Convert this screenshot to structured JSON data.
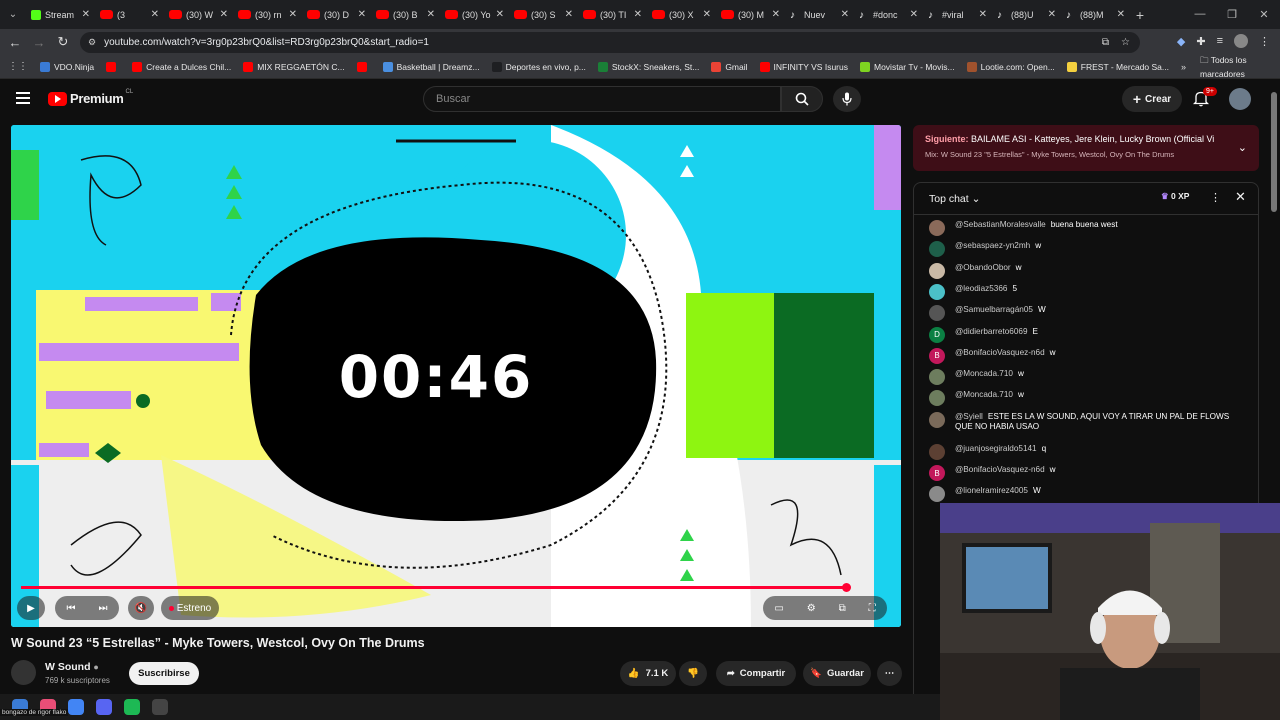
{
  "browser": {
    "tabs": [
      {
        "label": "Stream",
        "fav": "k"
      },
      {
        "label": "(3",
        "fav": "yt"
      },
      {
        "label": "(30) W",
        "fav": "yt"
      },
      {
        "label": "(30) rn",
        "fav": "yt"
      },
      {
        "label": "(30) D",
        "fav": "yt"
      },
      {
        "label": "(30) B",
        "fav": "yt"
      },
      {
        "label": "(30) Yo",
        "fav": "yt"
      },
      {
        "label": "(30) S",
        "fav": "yt"
      },
      {
        "label": "(30) TI",
        "fav": "yt"
      },
      {
        "label": "(30) X",
        "fav": "yt"
      },
      {
        "label": "(30) M",
        "fav": "yt"
      },
      {
        "label": "Nuev",
        "fav": "tt"
      },
      {
        "label": "#donc",
        "fav": "tt"
      },
      {
        "label": "#viral",
        "fav": "tt"
      },
      {
        "label": "(88)U",
        "fav": "tt"
      },
      {
        "label": "(88)M",
        "fav": "tt"
      }
    ],
    "url": "youtube.com/watch?v=3rg0p23brQ0&list=RD3rg0p23brQ0&start_radio=1",
    "bookmarks": [
      {
        "label": "VDO.Ninja",
        "color": "#3a7bd5"
      },
      {
        "label": "",
        "color": "#ff0000"
      },
      {
        "label": "Create a Dulces Chil...",
        "color": "#ff0000"
      },
      {
        "label": "MIX REGGAETÓN C...",
        "color": "#ff0000"
      },
      {
        "label": "",
        "color": "#ff0000"
      },
      {
        "label": "Basketball | Dreamz...",
        "color": "#4a8fe0"
      },
      {
        "label": "Deportes en vivo, p...",
        "color": "#1e1f22"
      },
      {
        "label": "StockX: Sneakers, St...",
        "color": "#1a7f37"
      },
      {
        "label": "Gmail",
        "color": "#ea4335"
      },
      {
        "label": "INFINITY VS Isurus",
        "color": "#ff0000"
      },
      {
        "label": "Movistar Tv - Movis...",
        "color": "#7ed321"
      },
      {
        "label": "Lootie.com: Open...",
        "color": "#a0522d"
      },
      {
        "label": "FREST - Mercado Sa...",
        "color": "#f4d03f"
      }
    ],
    "bookmarks_more": "»",
    "bookmarks_folder": "Todos los marcadores"
  },
  "yt": {
    "brand": "Premium",
    "country": "CL",
    "search_placeholder": "Buscar",
    "create_label": "Crear",
    "notif_badge": "9+"
  },
  "video": {
    "timer": "00:46",
    "premiere_label": "Estreno",
    "title": "W Sound 23 “5 Estrellas” - Myke Towers, Westcol, Ovy On The Drums",
    "channel": "W Sound",
    "subscribers": "769 k suscriptores",
    "subscribe_label": "Suscribirse",
    "likes": "7.1 K",
    "share_label": "Compartir",
    "save_label": "Guardar",
    "progress": 0.97
  },
  "next": {
    "prefix": "Siguiente:",
    "title": "BAILAME ASI - Katteyes, Jere Klein, Lucky Brown (Official Vi...",
    "mix": "Mix: W Sound 23 \"5 Estrellas\" - Myke Towers, Westcol, Ovy On The Drums"
  },
  "chat": {
    "mode": "Top chat",
    "xp": "0 XP",
    "messages": [
      {
        "name": "@SebastianMoralesvalle",
        "text": "buena buena west",
        "color": "#8a6a5a",
        "initial": ""
      },
      {
        "name": "@sebaspaez-yn2mh",
        "text": "w",
        "color": "#1e5f4a",
        "initial": ""
      },
      {
        "name": "@ObandoObor",
        "text": "w",
        "color": "#c9b9a6",
        "initial": ""
      },
      {
        "name": "@leodiaz5366",
        "text": "5",
        "color": "#4bc0c8",
        "initial": ""
      },
      {
        "name": "@Samuelbarragán05",
        "text": "W",
        "color": "#555555",
        "initial": ""
      },
      {
        "name": "@didierbarreto6069",
        "text": "E",
        "color": "#0b8043",
        "initial": "D"
      },
      {
        "name": "@BonifacioVasquez-n6d",
        "text": "w",
        "color": "#c2185b",
        "initial": "B"
      },
      {
        "name": "@Moncada.710",
        "text": "w",
        "color": "#6d7d5e",
        "initial": ""
      },
      {
        "name": "@Moncada.710",
        "text": "w",
        "color": "#6d7d5e",
        "initial": ""
      },
      {
        "name": "@Syiell",
        "text": "ESTE ES LA W SOUND, AQUI VOY A TIRAR UN PAL DE FLOWS QUE NO HABIA USAO",
        "color": "#7a6a5a",
        "initial": ""
      },
      {
        "name": "@juanjosegiraldo5141",
        "text": "q",
        "color": "#5c4033",
        "initial": ""
      },
      {
        "name": "@BonifacioVasquez-n6d",
        "text": "w",
        "color": "#c2185b",
        "initial": "B"
      },
      {
        "name": "@lionelramirez4005",
        "text": "W",
        "color": "#8a8a8a",
        "initial": ""
      }
    ]
  },
  "taskbar": {
    "note": "bongazo de rigor flako"
  }
}
